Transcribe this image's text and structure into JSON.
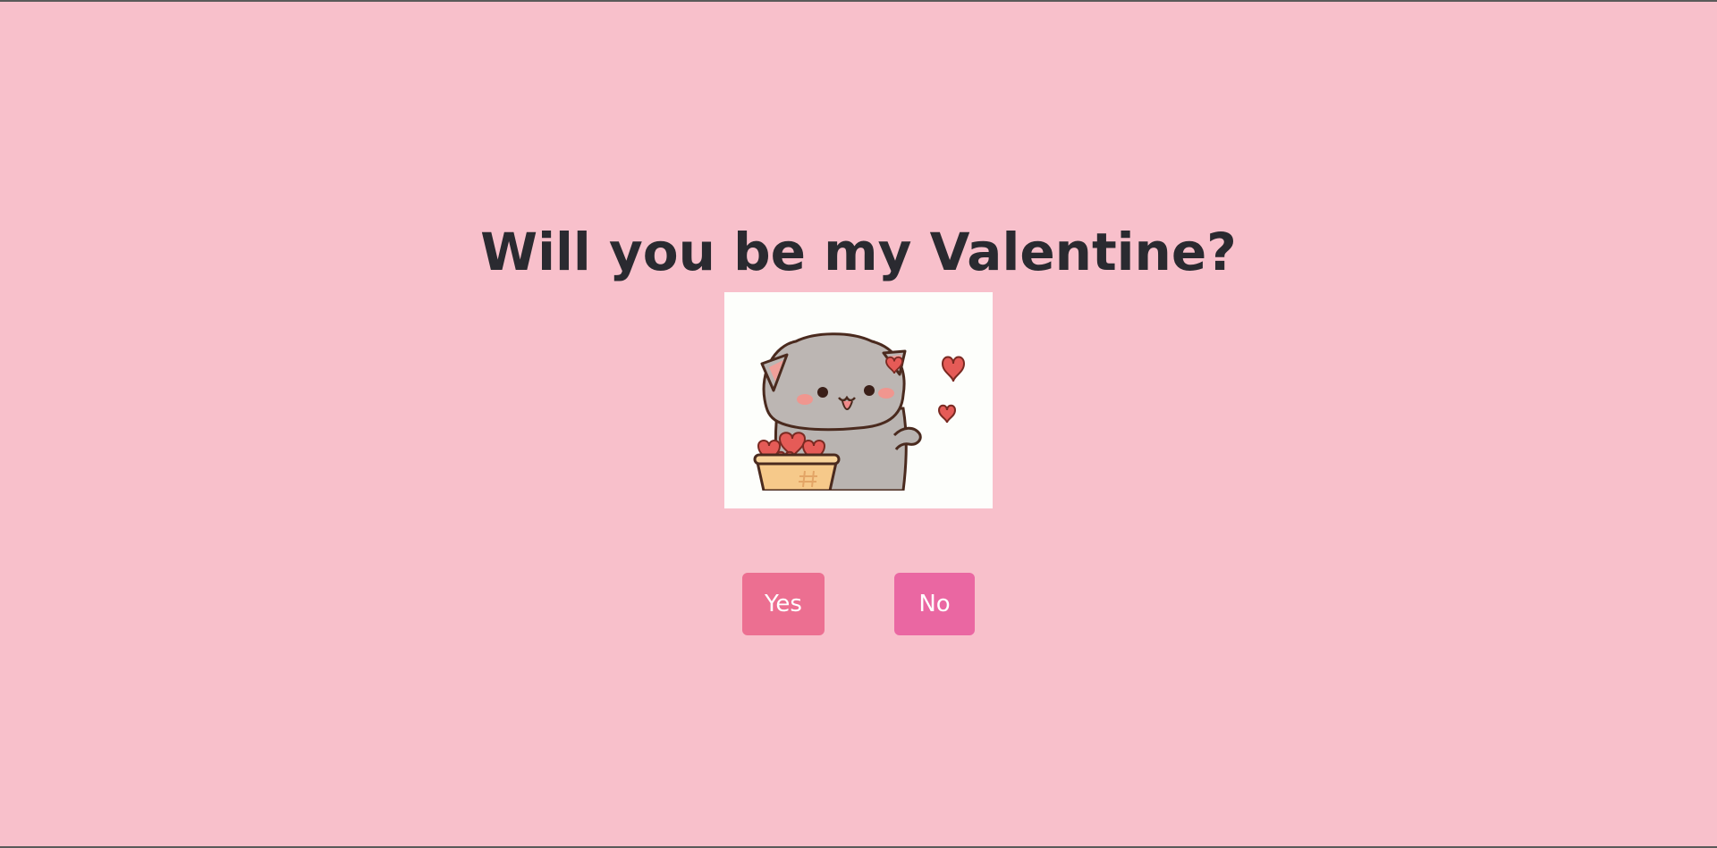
{
  "page": {
    "background_color": "#f8c0cb",
    "title": "Will you be my Valentine?"
  },
  "picture": {
    "subject": "cute grey cat holding a basket of hearts",
    "background_color": "#fdfefb"
  },
  "buttons": {
    "yes_label": "Yes",
    "yes_color": "#ec6f91",
    "no_label": "No",
    "no_color": "#ea67a2"
  }
}
